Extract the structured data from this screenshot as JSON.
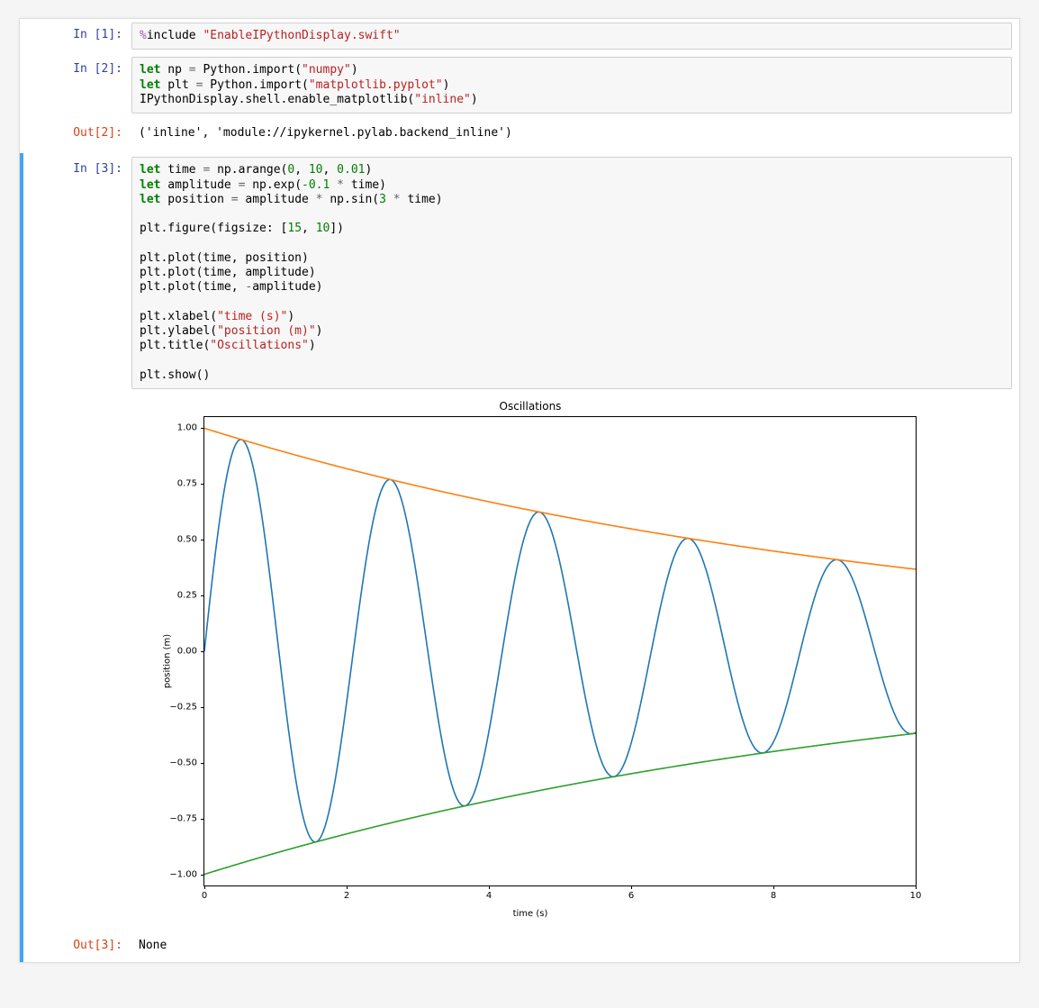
{
  "cells": {
    "c1": {
      "prompt_in": "In [1]:",
      "code_html": "<span class='tok-mag'>%</span>include <span class='tok-s'>\"EnableIPythonDisplay.swift\"</span>"
    },
    "c2": {
      "prompt_in": "In [2]:",
      "code_html": "<span class='tok-k'>let</span> np <span class='tok-o'>=</span> Python.import(<span class='tok-s'>\"numpy\"</span>)\n<span class='tok-k'>let</span> plt <span class='tok-o'>=</span> Python.import(<span class='tok-s'>\"matplotlib.pyplot\"</span>)\nIPythonDisplay.shell.enable_matplotlib(<span class='tok-s'>\"inline\"</span>)",
      "prompt_out": "Out[2]:",
      "output_text": "('inline', 'module://ipykernel.pylab.backend_inline')"
    },
    "c3": {
      "prompt_in": "In [3]:",
      "code_html": "<span class='tok-k'>let</span> time <span class='tok-o'>=</span> np.arange(<span class='tok-num'>0</span>, <span class='tok-num'>10</span>, <span class='tok-num'>0.01</span>)\n<span class='tok-k'>let</span> amplitude <span class='tok-o'>=</span> np.exp(<span class='tok-num'>-0.1</span> <span class='tok-o'>*</span> time)\n<span class='tok-k'>let</span> position <span class='tok-o'>=</span> amplitude <span class='tok-o'>*</span> np.sin(<span class='tok-num'>3</span> <span class='tok-o'>*</span> time)\n\nplt.figure(figsize: [<span class='tok-num'>15</span>, <span class='tok-num'>10</span>])\n\nplt.plot(time, position)\nplt.plot(time, amplitude)\nplt.plot(time, <span class='tok-o'>-</span>amplitude)\n\nplt.xlabel(<span class='tok-s'>\"time (s)\"</span>)\nplt.ylabel(<span class='tok-s'>\"position (m)\"</span>)\nplt.title(<span class='tok-s'>\"Oscillations\"</span>)\n\nplt.show()",
      "prompt_out": "Out[3]:",
      "output_text": "None"
    }
  },
  "chart_data": {
    "type": "line",
    "title": "Oscillations",
    "xlabel": "time (s)",
    "ylabel": "position (m)",
    "xlim": [
      0,
      10
    ],
    "ylim": [
      -1.05,
      1.05
    ],
    "xticks": [
      0,
      2,
      4,
      6,
      8,
      10
    ],
    "yticks": [
      -1.0,
      -0.75,
      -0.5,
      -0.25,
      0.0,
      0.25,
      0.5,
      0.75,
      1.0
    ],
    "ytick_labels": [
      "−1.00",
      "−0.75",
      "−0.50",
      "−0.25",
      "0.00",
      "0.25",
      "0.50",
      "0.75",
      "1.00"
    ],
    "series": [
      {
        "name": "position",
        "color": "#1f77b4",
        "formula": "exp(-0.1*t)*sin(3*t)",
        "t_start": 0,
        "t_end": 10,
        "dt": 0.01
      },
      {
        "name": "amplitude",
        "color": "#ff7f0e",
        "formula": "exp(-0.1*t)",
        "t_start": 0,
        "t_end": 10,
        "dt": 0.01
      },
      {
        "name": "-amplitude",
        "color": "#2ca02c",
        "formula": "-exp(-0.1*t)",
        "t_start": 0,
        "t_end": 10,
        "dt": 0.01
      }
    ]
  }
}
